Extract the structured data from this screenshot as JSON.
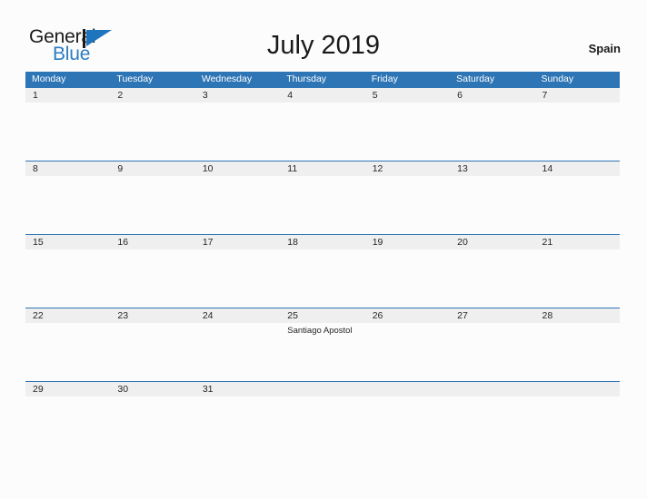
{
  "header": {
    "logo": {
      "line1": "General",
      "line2": "Blue",
      "mark_icon": "triangle-flag-icon",
      "line1_color": "#1a1a1a",
      "line2_color": "#2b7cc4",
      "mark_color": "#1f75bd"
    },
    "title": "July 2019",
    "region": "Spain"
  },
  "colors": {
    "header_blue": "#2e75b6",
    "band_gray": "#efefef",
    "page_background": "#fcfcfc",
    "text": "#262626",
    "header_text": "#ffffff"
  },
  "calendar": {
    "weekdays": [
      "Monday",
      "Tuesday",
      "Wednesday",
      "Thursday",
      "Friday",
      "Saturday",
      "Sunday"
    ],
    "weeks": [
      {
        "days": [
          {
            "number": "1",
            "events": []
          },
          {
            "number": "2",
            "events": []
          },
          {
            "number": "3",
            "events": []
          },
          {
            "number": "4",
            "events": []
          },
          {
            "number": "5",
            "events": []
          },
          {
            "number": "6",
            "events": []
          },
          {
            "number": "7",
            "events": []
          }
        ]
      },
      {
        "days": [
          {
            "number": "8",
            "events": []
          },
          {
            "number": "9",
            "events": []
          },
          {
            "number": "10",
            "events": []
          },
          {
            "number": "11",
            "events": []
          },
          {
            "number": "12",
            "events": []
          },
          {
            "number": "13",
            "events": []
          },
          {
            "number": "14",
            "events": []
          }
        ]
      },
      {
        "days": [
          {
            "number": "15",
            "events": []
          },
          {
            "number": "16",
            "events": []
          },
          {
            "number": "17",
            "events": []
          },
          {
            "number": "18",
            "events": []
          },
          {
            "number": "19",
            "events": []
          },
          {
            "number": "20",
            "events": []
          },
          {
            "number": "21",
            "events": []
          }
        ]
      },
      {
        "days": [
          {
            "number": "22",
            "events": []
          },
          {
            "number": "23",
            "events": []
          },
          {
            "number": "24",
            "events": []
          },
          {
            "number": "25",
            "events": [
              "Santiago Apostol"
            ]
          },
          {
            "number": "26",
            "events": []
          },
          {
            "number": "27",
            "events": []
          },
          {
            "number": "28",
            "events": []
          }
        ]
      },
      {
        "days": [
          {
            "number": "29",
            "events": []
          },
          {
            "number": "30",
            "events": []
          },
          {
            "number": "31",
            "events": []
          },
          {
            "number": "",
            "events": []
          },
          {
            "number": "",
            "events": []
          },
          {
            "number": "",
            "events": []
          },
          {
            "number": "",
            "events": []
          }
        ]
      }
    ]
  }
}
